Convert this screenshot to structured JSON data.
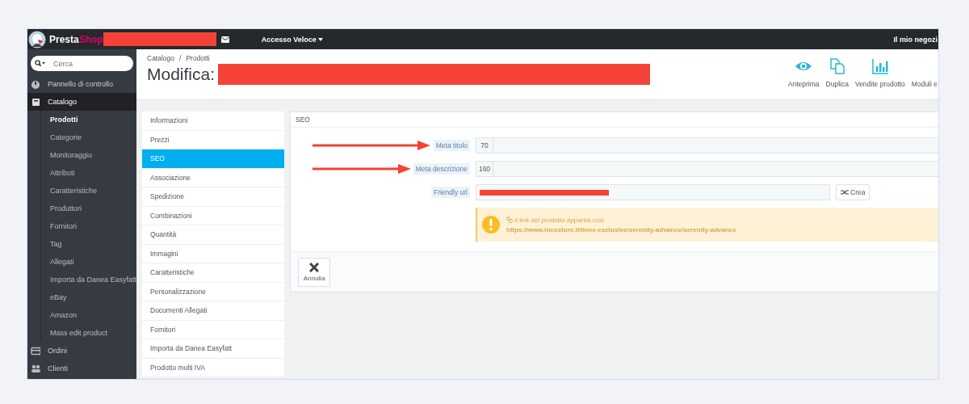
{
  "topbar": {
    "brand_a": "Presta",
    "brand_b": "Shop",
    "redacted": true,
    "quick_access": "Accesso Veloce",
    "shop_link": "Il mio negozi"
  },
  "sidebar": {
    "search": {
      "placeholder": "Cerca"
    },
    "items": [
      {
        "label": "Pannello di controllo",
        "selected": false
      },
      {
        "label": "Catalogo",
        "selected": true,
        "expanded": true,
        "children": [
          {
            "label": "Prodotti",
            "selected": true
          },
          {
            "label": "Categorie",
            "selected": false
          },
          {
            "label": "Monitoraggio",
            "selected": false
          },
          {
            "label": "Attributi",
            "selected": false
          },
          {
            "label": "Caratteristiche",
            "selected": false
          },
          {
            "label": "Produttori",
            "selected": false
          },
          {
            "label": "Fornitori",
            "selected": false
          },
          {
            "label": "Tag",
            "selected": false
          },
          {
            "label": "Allegati",
            "selected": false
          },
          {
            "label": "Importa da Danea Easyfatt",
            "selected": false
          },
          {
            "label": "eBay",
            "selected": false
          },
          {
            "label": "Amazon",
            "selected": false
          },
          {
            "label": "Mass edit product",
            "selected": false
          }
        ]
      },
      {
        "label": "Ordini",
        "selected": false
      },
      {
        "label": "Clienti",
        "selected": false
      }
    ]
  },
  "header": {
    "breadcrumb": {
      "items": [
        "Catalogo",
        "Prodotti"
      ],
      "separator": "/"
    },
    "title": "Modifica:",
    "redacted": true,
    "toolbar": [
      {
        "label": "Anteprima"
      },
      {
        "label": "Duplica"
      },
      {
        "label": "Vendite prodotto"
      },
      {
        "label": "Moduli e"
      }
    ]
  },
  "tabs": [
    {
      "label": "Informazioni",
      "selected": false
    },
    {
      "label": "Prezzi",
      "selected": false
    },
    {
      "label": "SEO",
      "selected": true
    },
    {
      "label": "Associazione",
      "selected": false
    },
    {
      "label": "Spedizione",
      "selected": false
    },
    {
      "label": "Combinazioni",
      "selected": false
    },
    {
      "label": "Quantità",
      "selected": false
    },
    {
      "label": "Immagini",
      "selected": false
    },
    {
      "label": "Caratteristiche",
      "selected": false
    },
    {
      "label": "Personalizzazione",
      "selected": false
    },
    {
      "label": "Documenti Allegati",
      "selected": false
    },
    {
      "label": "Fornitori",
      "selected": false
    },
    {
      "label": "Importa da Danea Easyfatt",
      "selected": false
    },
    {
      "label": "Prodotto multi IVA",
      "selected": false
    }
  ],
  "panel": {
    "title": "SEO",
    "fields": [
      {
        "kind": "counter",
        "label": "Meta titolo",
        "counter": "70",
        "arrow": true
      },
      {
        "kind": "counter",
        "label": "Meta descrizione",
        "counter": "160",
        "arrow": true
      },
      {
        "kind": "url",
        "label": "Friendly url",
        "redacted": true,
        "button": "Crea"
      }
    ],
    "alert": {
      "text": "Il link del prodotto apparirà cosi",
      "url": "https://www.incostore.it/linee-esclusive/serenity-advance/serenity-advance"
    },
    "footer_button": "Annulla"
  }
}
